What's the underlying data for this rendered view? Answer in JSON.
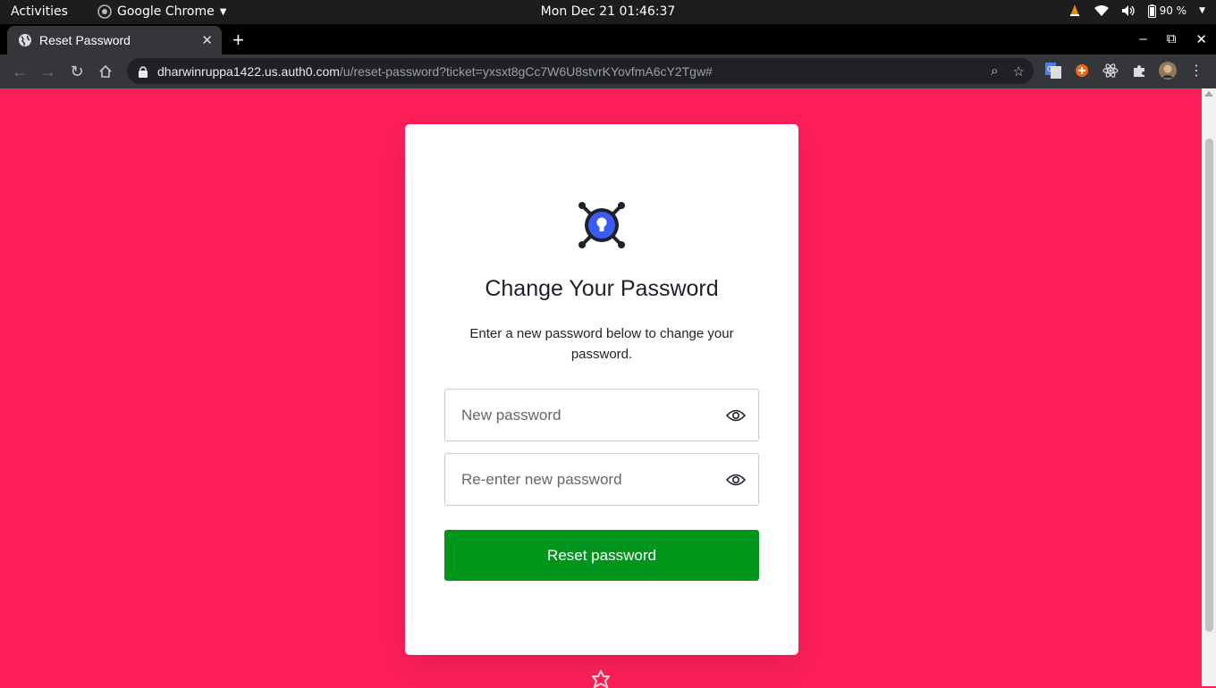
{
  "system_bar": {
    "activities": "Activities",
    "app_name": "Google Chrome",
    "clock": "Mon Dec 21  01:46:37",
    "battery": "90 %"
  },
  "browser": {
    "tab_title": "Reset Password",
    "url_host": "dharwinruppa1422.us.auth0.com",
    "url_path": "/u/reset-password?ticket=yxsxt8gCc7W6U8stvrKYovfmA6cY2Tgw#"
  },
  "form": {
    "heading": "Change Your Password",
    "description": "Enter a new password below to change your password.",
    "new_password_placeholder": "New password",
    "confirm_password_placeholder": "Re-enter new password",
    "submit_label": "Reset password"
  },
  "colors": {
    "page_background": "#ff1f5a",
    "submit_button": "#00961c",
    "logo_accent": "#3b5bf5"
  },
  "icons": {
    "logo": "keyhole-lock-icon",
    "toggle_visibility": "eye-icon"
  }
}
